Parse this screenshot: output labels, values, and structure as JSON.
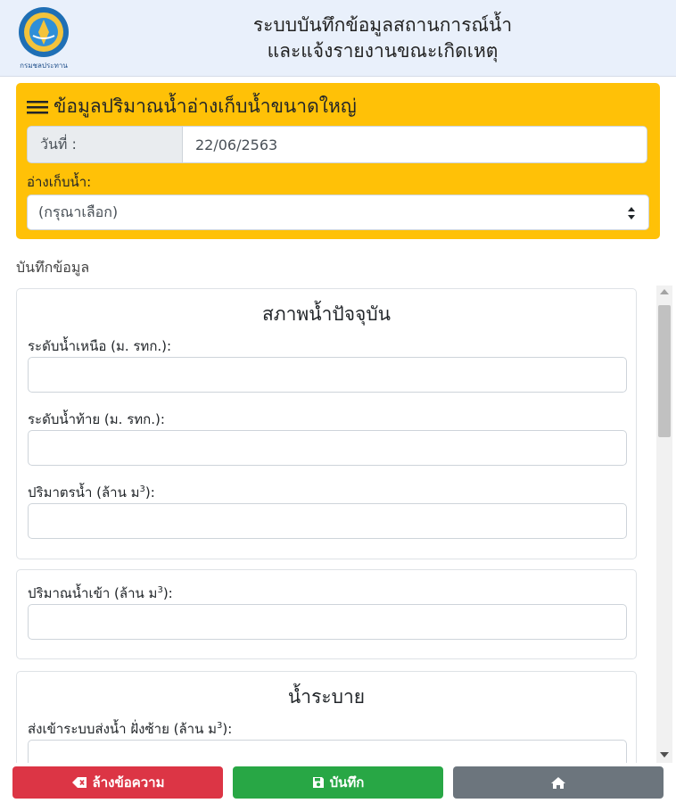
{
  "header": {
    "title_line1": "ระบบบันทึกข้อมูลสถานการณ์น้ำ",
    "title_line2": "และแจ้งรายงานขณะเกิดเหตุ",
    "logo_text": "กรมชลประทาน"
  },
  "panel": {
    "title": "ข้อมูลปริมาณน้ำอ่างเก็บน้ำขนาดใหญ่",
    "date_label": "วันที่ :",
    "date_value": "22/06/2563",
    "reservoir_label": "อ่างเก็บน้ำ:",
    "reservoir_selected": "(กรุณาเลือก)"
  },
  "section_label": "บันทึกข้อมูล",
  "card_current": {
    "title": "สภาพน้ำปัจจุบัน",
    "upstream_label": "ระดับน้ำเหนือ (ม. รทก.):",
    "downstream_label": "ระดับน้ำท้าย (ม. รทก.):",
    "volume_label_prefix": "ปริมาตรน้ำ (ล้าน ม",
    "volume_label_suffix": "):"
  },
  "card_inflow": {
    "inflow_label_prefix": "ปริมาณน้ำเข้า (ล้าน ม",
    "inflow_label_suffix": "):"
  },
  "card_release": {
    "title": "น้ำระบาย",
    "left_bank_label_prefix": "ส่งเข้าระบบส่งน้ำ ฝั่งซ้าย (ล้าน ม",
    "left_bank_label_suffix": "):"
  },
  "unit_superscript": "3",
  "buttons": {
    "clear_label": "ล้างข้อความ",
    "save_label": "บันทึก"
  },
  "colors": {
    "panel": "#ffc107",
    "clear": "#dc3545",
    "save": "#28a745",
    "home": "#6c757d"
  }
}
